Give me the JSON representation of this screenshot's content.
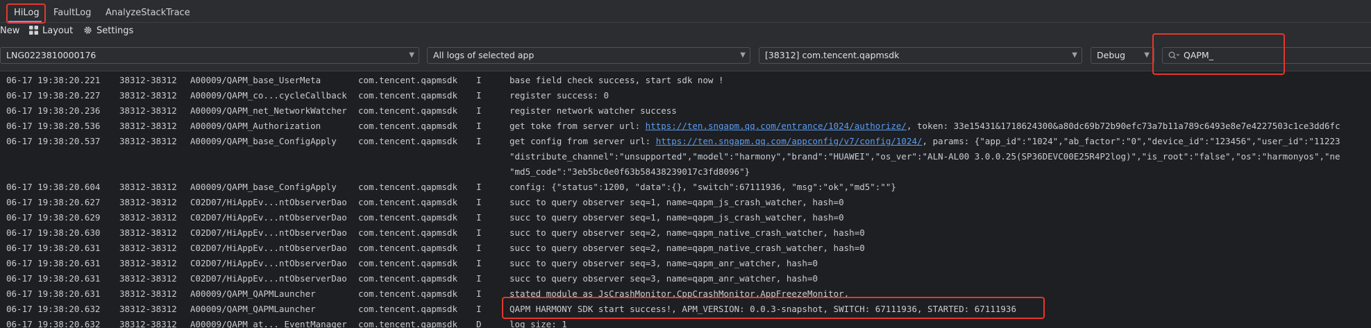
{
  "tabs": [
    {
      "label": "HiLog"
    },
    {
      "label": "FaultLog"
    },
    {
      "label": "AnalyzeStackTrace"
    }
  ],
  "toolbar": {
    "new_label": "New",
    "layout_label": "Layout",
    "settings_label": "Settings"
  },
  "filters": {
    "device": "LNG0223810000176",
    "log_scope": "All logs of selected app",
    "process": "[38312] com.tencent.qapmsdk",
    "level": "Debug",
    "search_value": "QAPM_"
  },
  "colors": {
    "highlight": "#e5372d",
    "link": "#5b9cf0",
    "accent": "#6b9bfa"
  },
  "log_rows": [
    {
      "ts": "06-17 19:38:20.221",
      "pid": "38312-38312",
      "tag": "A00009/QAPM_base_UserMeta",
      "pkg": "com.tencent.qapmsdk",
      "lvl": "I",
      "msg": "base field check success, start sdk now !"
    },
    {
      "ts": "06-17 19:38:20.227",
      "pid": "38312-38312",
      "tag": "A00009/QAPM_co...cycleCallback",
      "pkg": "com.tencent.qapmsdk",
      "lvl": "I",
      "msg": "register success: 0"
    },
    {
      "ts": "06-17 19:38:20.236",
      "pid": "38312-38312",
      "tag": "A00009/QAPM_net_NetworkWatcher",
      "pkg": "com.tencent.qapmsdk",
      "lvl": "I",
      "msg": "register network watcher success"
    },
    {
      "ts": "06-17 19:38:20.536",
      "pid": "38312-38312",
      "tag": "A00009/QAPM_Authorization",
      "pkg": "com.tencent.qapmsdk",
      "lvl": "I",
      "msg_pre": "get toke from server url: ",
      "link": "https://ten.sngapm.qq.com/entrance/1024/authorize/",
      "msg_post": ", token: 33e15431&1718624300&a80dc69b72b90efc73a7b11a789c6493e8e7e4227503c1ce3dd6fc"
    },
    {
      "ts": "06-17 19:38:20.537",
      "pid": "38312-38312",
      "tag": "A00009/QAPM_base_ConfigApply",
      "pkg": "com.tencent.qapmsdk",
      "lvl": "I",
      "msg_pre": "get config from server url: ",
      "link": "https://ten.sngapm.qq.com/appconfig/v7/config/1024/",
      "msg_post": ", params: {\"app_id\":\"1024\",\"ab_factor\":\"0\",\"device_id\":\"123456\",\"user_id\":\"11223"
    },
    {
      "cont": "\"distribute_channel\":\"unsupported\",\"model\":\"harmony\",\"brand\":\"HUAWEI\",\"os_ver\":\"ALN-AL00 3.0.0.25(SP36DEVC00E25R4P2log)\",\"is_root\":\"false\",\"os\":\"harmonyos\",\"ne"
    },
    {
      "cont": "\"md5_code\":\"3eb5bc0e0f63b58438239017c3fd8096\"}"
    },
    {
      "ts": "06-17 19:38:20.604",
      "pid": "38312-38312",
      "tag": "A00009/QAPM_base_ConfigApply",
      "pkg": "com.tencent.qapmsdk",
      "lvl": "I",
      "msg": "config: {\"status\":1200, \"data\":{}, \"switch\":67111936, \"msg\":\"ok\",\"md5\":\"\"}"
    },
    {
      "ts": "06-17 19:38:20.627",
      "pid": "38312-38312",
      "tag": "C02D07/HiAppEv...ntObserverDao",
      "pkg": "com.tencent.qapmsdk",
      "lvl": "I",
      "msg": "succ to query observer seq=1, name=qapm_js_crash_watcher, hash=0"
    },
    {
      "ts": "06-17 19:38:20.629",
      "pid": "38312-38312",
      "tag": "C02D07/HiAppEv...ntObserverDao",
      "pkg": "com.tencent.qapmsdk",
      "lvl": "I",
      "msg": "succ to query observer seq=1, name=qapm_js_crash_watcher, hash=0"
    },
    {
      "ts": "06-17 19:38:20.630",
      "pid": "38312-38312",
      "tag": "C02D07/HiAppEv...ntObserverDao",
      "pkg": "com.tencent.qapmsdk",
      "lvl": "I",
      "msg": "succ to query observer seq=2, name=qapm_native_crash_watcher, hash=0"
    },
    {
      "ts": "06-17 19:38:20.631",
      "pid": "38312-38312",
      "tag": "C02D07/HiAppEv...ntObserverDao",
      "pkg": "com.tencent.qapmsdk",
      "lvl": "I",
      "msg": "succ to query observer seq=2, name=qapm_native_crash_watcher, hash=0"
    },
    {
      "ts": "06-17 19:38:20.631",
      "pid": "38312-38312",
      "tag": "C02D07/HiAppEv...ntObserverDao",
      "pkg": "com.tencent.qapmsdk",
      "lvl": "I",
      "msg": "succ to query observer seq=3, name=qapm_anr_watcher, hash=0"
    },
    {
      "ts": "06-17 19:38:20.631",
      "pid": "38312-38312",
      "tag": "C02D07/HiAppEv...ntObserverDao",
      "pkg": "com.tencent.qapmsdk",
      "lvl": "I",
      "msg": "succ to query observer seq=3, name=qapm_anr_watcher, hash=0"
    },
    {
      "ts": "06-17 19:38:20.631",
      "pid": "38312-38312",
      "tag": "A00009/QAPM_QAPMLauncher",
      "pkg": "com.tencent.qapmsdk",
      "lvl": "I",
      "msg": "stated module as JsCrashMonitor,CppCrashMonitor,AppFreezeMonitor,"
    },
    {
      "ts": "06-17 19:38:20.632",
      "pid": "38312-38312",
      "tag": "A00009/QAPM_QAPMLauncher",
      "pkg": "com.tencent.qapmsdk",
      "lvl": "I",
      "msg": "QAPM HARMONY SDK start success!, APM_VERSION: 0.0.3-snapshot, SWITCH: 67111936, STARTED: 67111936"
    },
    {
      "ts": "06-17 19:38:20.632",
      "pid": "38312-38312",
      "tag": "A00009/QAPM_at..._EventManager",
      "pkg": "com.tencent.qapmsdk",
      "lvl": "D",
      "msg": "log size: 1"
    }
  ]
}
